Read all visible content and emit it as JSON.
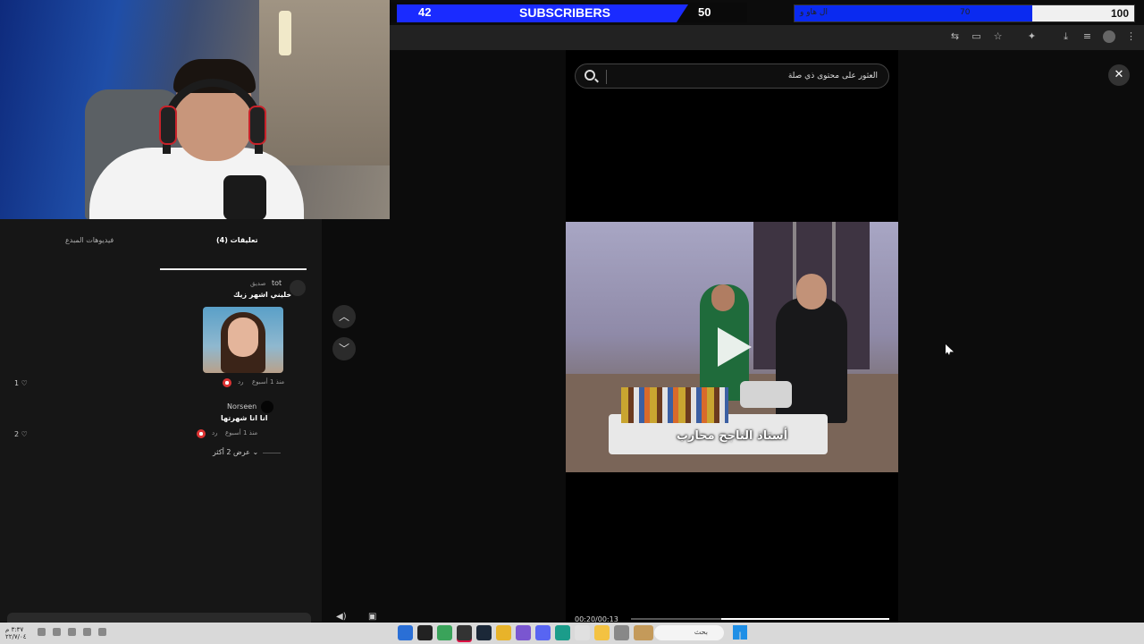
{
  "overlay": {
    "subscribers_left": "42",
    "subscribers_label": "SUBSCRIBERS",
    "subscribers_right": "50",
    "goal_text": "ال هاو و",
    "goal_mid": "70",
    "goal_max": "100",
    "goal_fraction": 0.7
  },
  "browser_toolbar": {
    "icons": [
      "translate-icon",
      "cast-icon",
      "star-icon",
      "extensions-icon",
      "download-icon",
      "reading-list-icon",
      "profile-avatar",
      "menu-icon"
    ]
  },
  "comments_panel": {
    "tabs": [
      {
        "label": "(4) تعليقات",
        "active": true
      },
      {
        "label": "فيديوهات المبدع",
        "active": false
      }
    ],
    "comments": [
      {
        "username": "tot",
        "badge": "صديق",
        "text": "خليني اشهر زيك",
        "has_sticker": true,
        "time": "منذ 1 أسبوع",
        "reply": "رد",
        "likes": "1"
      },
      {
        "username": "Norseen",
        "text": "انا انا شهرتها",
        "time": "منذ 1 أسبوع",
        "reply": "رد",
        "likes": "2"
      }
    ],
    "show_more": "عرض 2 أكثر"
  },
  "video_panel": {
    "search_placeholder": "العثور على محتوى ذي صلة",
    "caption": "أستاذ الناجح محارب",
    "timecode": "00:20/00:13",
    "progress_fraction": 0.65
  },
  "taskbar": {
    "clock_time": "٣:٣٧ م",
    "clock_date": "٢٢/٧/٠٤",
    "search_label": "بحث"
  },
  "colors": {
    "subscriber_blue": "#1a2bff",
    "background": "#0c0c0c",
    "panel": "#161616"
  }
}
